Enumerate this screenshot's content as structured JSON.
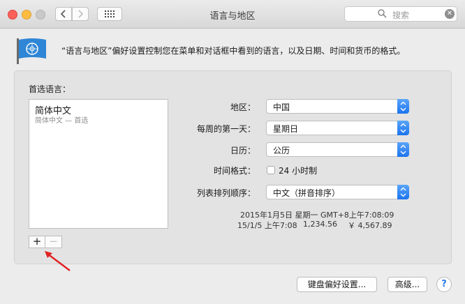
{
  "window": {
    "title": "语言与地区"
  },
  "search": {
    "placeholder": "搜索"
  },
  "description": "“语言与地区”偏好设置控制您在菜单和对话框中看到的语言，以及日期、时间和货币的格式。",
  "preferred": {
    "label": "首选语言：",
    "languages": [
      {
        "name": "简体中文",
        "sub": "简体中文 — 首选"
      }
    ],
    "add_label": "+",
    "remove_label": "−"
  },
  "settings": {
    "region": {
      "label": "地区：",
      "value": "中国"
    },
    "first_day": {
      "label": "每周的第一天：",
      "value": "星期日"
    },
    "calendar": {
      "label": "日历：",
      "value": "公历"
    },
    "time_format": {
      "label": "时间格式：",
      "checkbox_label": "24 小时制",
      "checked": false
    },
    "sort_order": {
      "label": "列表排列顺序：",
      "value": "中文（拼音排序）"
    }
  },
  "samples": {
    "line1": "2015年1月5日 星期一 GMT+8上午7:08:09",
    "date": "15/1/5 上午7:08",
    "number": "1,234.56",
    "currency": "￥ 4,567.89"
  },
  "buttons": {
    "keyboard": "键盘偏好设置...",
    "advanced": "高级...",
    "help": "?"
  },
  "colors": {
    "accent": "#1c74ee",
    "flag": "#2f86d6",
    "arrow": "#e02323"
  }
}
